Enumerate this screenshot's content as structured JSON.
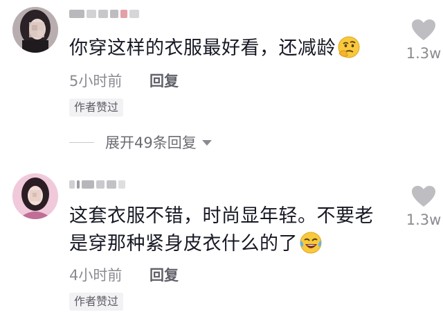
{
  "comments": [
    {
      "text": "你穿这样的衣服最好看，还减龄",
      "emoji_icon": "thinking-emoji",
      "time": "5小时前",
      "reply_label": "回复",
      "badge": "作者赞过",
      "likes": "1.3w"
    },
    {
      "text": "这套衣服不错，时尚显年轻。不要老是穿那种紧身皮衣什么的了",
      "emoji_icon": "laughing-tears-emoji",
      "time": "4小时前",
      "reply_label": "回复",
      "badge": "作者赞过",
      "likes": "1.3w"
    }
  ],
  "expand_replies": {
    "label": "展开49条回复",
    "icon": "caret-down-icon"
  },
  "colors": {
    "text": "#161823",
    "muted": "#8a8b91",
    "heart": "#bdbdc2",
    "badge_bg": "#f2f2f4"
  }
}
